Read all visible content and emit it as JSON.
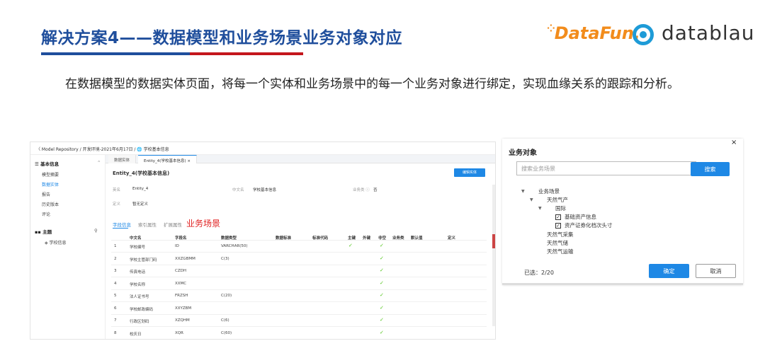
{
  "slide": {
    "title": "解决方案4——数据模型和业务场景业务对象对应",
    "paragraph": "在数据模型的数据实体页面，将每一个实体和业务场景中的每一个业务对象进行绑定，实现血缘关系的跟踪和分析。",
    "logo_datafun": "DataFun.",
    "logo_datablau": "datablau",
    "colors": {
      "title": "#1f4e9c",
      "accent_red": "#c4161c",
      "primary": "#1e88e5",
      "check": "#52c41a",
      "highlight": "#e02020"
    }
  },
  "screenshot": {
    "breadcrumb": "〈 Model Repository / 开发环境-2021年6月17日 / 🌐 学校基本信息",
    "sidebar": {
      "basic_info": "基本信息",
      "items": [
        "模型摘要",
        "数据实体",
        "报告",
        "历史版本",
        "评论"
      ],
      "active_item": "数据实体",
      "theme_header": "主题",
      "theme_items": [
        "学校信息"
      ]
    },
    "tabs": [
      "数据实体",
      "Entity_4(学校基本信息)  ×"
    ],
    "entity_title": "Entity_4(学校基本信息)",
    "edit_button": "编辑实体",
    "fields": {
      "name_label": "英名",
      "name_value": "Entity_4",
      "cn_label": "中文名",
      "cn_value": "学校基本信息",
      "biz_label": "业务类 ⓘ",
      "biz_value": "否",
      "def_label": "定义",
      "def_value": "暂无定义"
    },
    "subtabs": [
      "字段信息",
      "索引属性",
      "扩展属性"
    ],
    "biz_scene_label": "业务场景",
    "table": {
      "headers": [
        "中文名",
        "字段名",
        "数据类型",
        "数据标准",
        "标准代码",
        "主键",
        "外键",
        "非空",
        "业务类",
        "默认值",
        "定义"
      ],
      "rows": [
        {
          "no": "1",
          "cn": "学校编号",
          "field": "ID",
          "type": "VARCHAR(50)",
          "pk": "✓",
          "notnull": "✓"
        },
        {
          "no": "2",
          "cn": "学校主管部门码",
          "field": "XXZGBMM",
          "type": "C(3)",
          "pk": "",
          "notnull": "✓"
        },
        {
          "no": "3",
          "cn": "传真电话",
          "field": "CZDH",
          "type": "",
          "pk": "",
          "notnull": "✓"
        },
        {
          "no": "4",
          "cn": "学校名称",
          "field": "XXMC",
          "type": "",
          "pk": "",
          "notnull": "✓"
        },
        {
          "no": "5",
          "cn": "法人证书号",
          "field": "FRZSH",
          "type": "C(20)",
          "pk": "",
          "notnull": "✓"
        },
        {
          "no": "6",
          "cn": "学校邮政编码",
          "field": "XXYZBM",
          "type": "",
          "pk": "",
          "notnull": "✓"
        },
        {
          "no": "7",
          "cn": "行政区划码",
          "field": "XZQHM",
          "type": "C(6)",
          "pk": "",
          "notnull": "✓"
        },
        {
          "no": "8",
          "cn": "校庆日",
          "field": "XQR",
          "type": "C(60)",
          "pk": "",
          "notnull": "✓"
        }
      ]
    }
  },
  "dialog": {
    "title": "业务对象",
    "close": "×",
    "search_placeholder": "搜索业务场景",
    "search_button": "搜索",
    "tree": {
      "root": "业务场景",
      "level1": "天然气产",
      "level2": "国际",
      "leaf1": "基础资产信息",
      "leaf2": "资产证券化档次头寸",
      "others": [
        "天然气采集",
        "天然气储",
        "天然气运输"
      ]
    },
    "selected_count": "已选：2/20",
    "ok_button": "确定",
    "cancel_button": "取消"
  }
}
